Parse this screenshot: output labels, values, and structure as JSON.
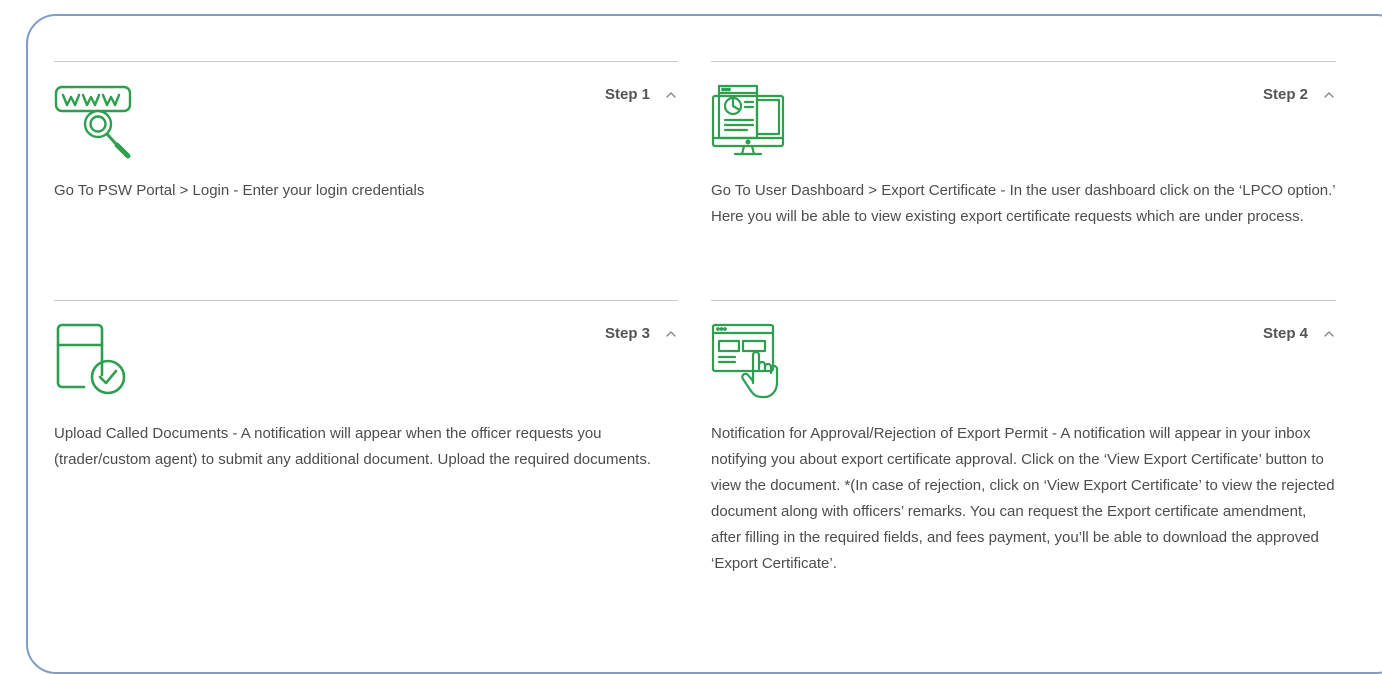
{
  "colors": {
    "accent": "#2e9e4f",
    "frame_border": "#7f9cc9",
    "divider": "#c9c9c9",
    "text": "#4d4d4d"
  },
  "steps": [
    {
      "label": "Step 1",
      "icon": "www-search-icon",
      "expanded": true,
      "description": "Go To PSW Portal > Login - Enter your login credentials"
    },
    {
      "label": "Step 2",
      "icon": "dashboard-monitor-icon",
      "expanded": true,
      "description": "Go To User Dashboard > Export Certificate - In the user dashboard click on the ‘LPCO option.’ Here you will be able to view existing export certificate requests which are under process."
    },
    {
      "label": "Step 3",
      "icon": "upload-document-check-icon",
      "expanded": true,
      "description": "Upload Called Documents - A notification will appear when the officer requests you (trader/custom agent) to submit any additional document. Upload the required documents."
    },
    {
      "label": "Step 4",
      "icon": "browser-click-icon",
      "expanded": true,
      "description": "Notification for Approval/Rejection of Export Permit - A notification will appear in your inbox notifying you about export certificate approval. Click on the ‘View Export Certificate’ button to view the document. *(In case of rejection, click on ‘View Export Certificate’ to view the rejected document along with officers’ remarks. You can request the Export certificate amendment, after filling in the required fields, and fees payment, you’ll be able to download the approved ‘Export Certificate’."
    }
  ]
}
